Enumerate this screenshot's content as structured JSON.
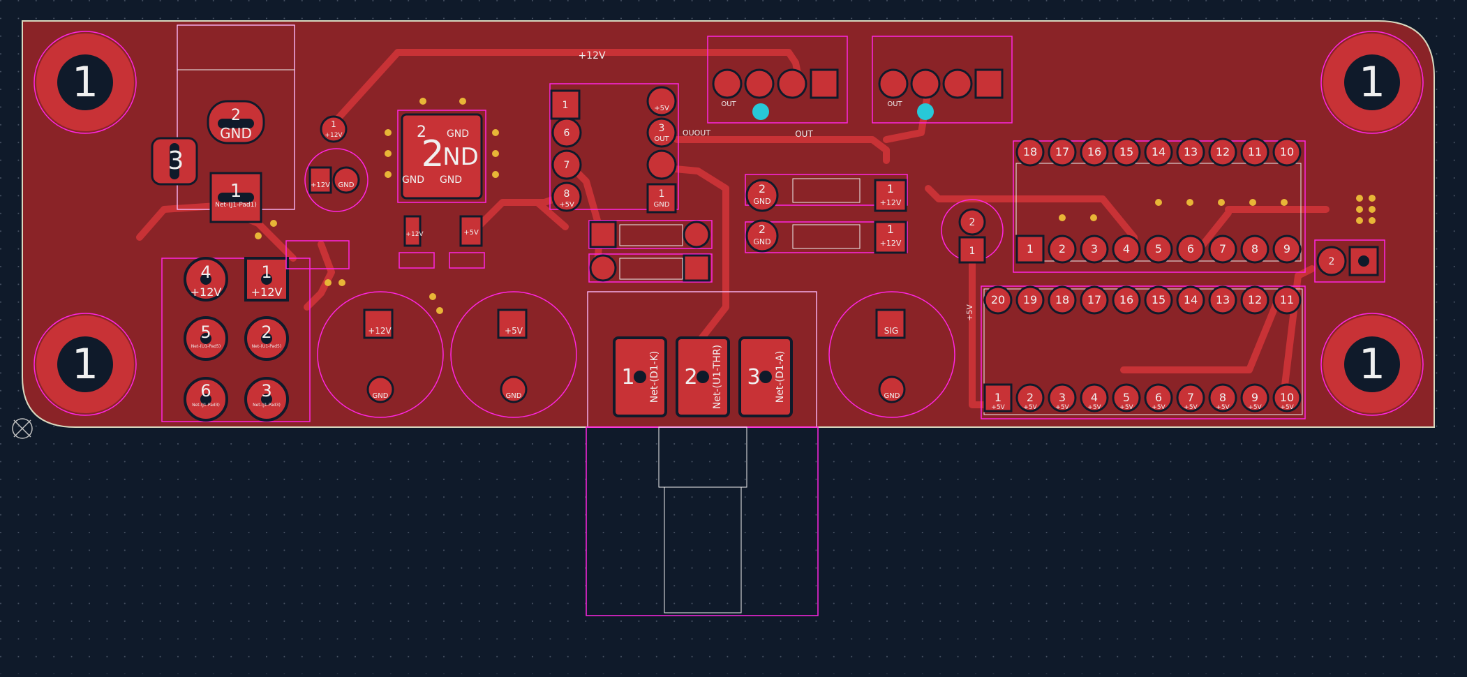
{
  "colors": {
    "background": "#0f1a2a",
    "grid_dot": "#4a5566",
    "copper": "#c83236",
    "copper_fill": "#8a2327",
    "board_edge": "#d9d9c0",
    "silkscreen": "#f0f0f0",
    "courtyard": "#ff26e2",
    "via": "#e8b637",
    "drill": "#0f1a2a",
    "highlight_via": "#28c8d8"
  },
  "nets": {
    "p12v": "+12V",
    "p5v": "+5V",
    "gnd": "GND",
    "out": "OUT",
    "ouout": "OUOUT",
    "sig": "SIG",
    "j1_pad": "Net-(J1-Pad1)",
    "j1_pad_b": "Net-(J1-Pad3)",
    "dk": "Net-(D1-K)",
    "thr": "Net-(U1-THR)",
    "da": "Net-(D1-A)",
    "net_u1": "Net-(U1-Pad5)"
  },
  "pads": {
    "mount": "1",
    "n1": "1",
    "n2": "2",
    "n3": "3",
    "n4": "4",
    "n5": "5",
    "n6": "6",
    "n7": "7",
    "n8": "8",
    "n9": "9",
    "n10": "10",
    "n11": "11",
    "n12": "12",
    "n13": "13",
    "n14": "14",
    "n15": "15",
    "n16": "16",
    "n17": "17",
    "n18": "18",
    "n19": "19",
    "n20": "20"
  },
  "labels": {
    "big2": "2",
    "nd": "ND",
    "nd_prefix": "2-",
    "gnd_small": "GND"
  },
  "ic_top_row": [
    "18",
    "17",
    "16",
    "15",
    "14",
    "13",
    "12",
    "11",
    "10"
  ],
  "ic_bot_row": [
    "1",
    "2",
    "3",
    "4",
    "5",
    "6",
    "7",
    "8",
    "9"
  ],
  "socket_top_row": [
    "20",
    "19",
    "18",
    "17",
    "16",
    "15",
    "14",
    "13",
    "12",
    "11"
  ],
  "socket_bot_row": [
    "1",
    "2",
    "3",
    "4",
    "5",
    "6",
    "7",
    "8",
    "9",
    "10"
  ]
}
